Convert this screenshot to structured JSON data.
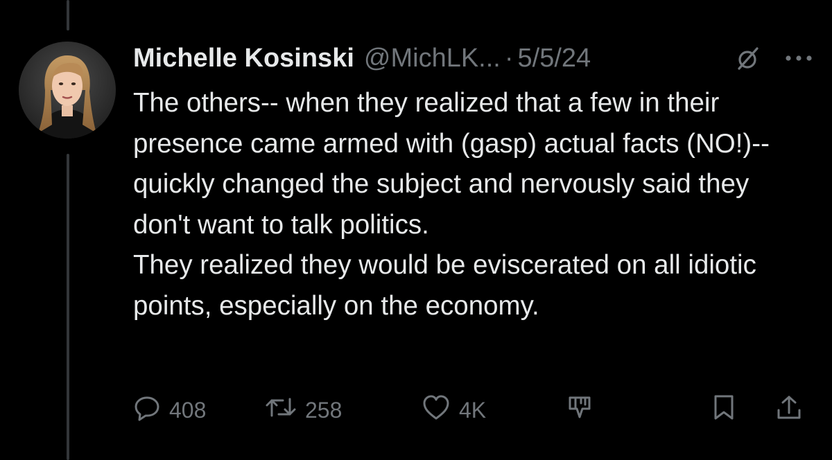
{
  "tweet": {
    "author_name": "Michelle Kosinski",
    "handle": "@MichLK...",
    "separator": "·",
    "date": "5/5/24",
    "paragraphs": [
      "The others-- when they realized that a few in their presence came armed with (gasp) actual facts (NO!)-- quickly changed the subject and nervously said they don't want to talk politics.",
      "They realized they would be eviscerated on all idiotic points, especially on the economy."
    ]
  },
  "actions": {
    "replies": "408",
    "reposts": "258",
    "likes": "4K"
  },
  "icons": {
    "header": [
      "grok-icon",
      "more-options-icon"
    ],
    "actions": [
      "reply-icon",
      "repost-icon",
      "like-icon",
      "grok-icon",
      "bookmark-icon",
      "share-icon"
    ]
  },
  "colors": {
    "background": "#000000",
    "primary_text": "#e7e9ea",
    "secondary_text": "#71767b",
    "thread_line": "#333639"
  }
}
